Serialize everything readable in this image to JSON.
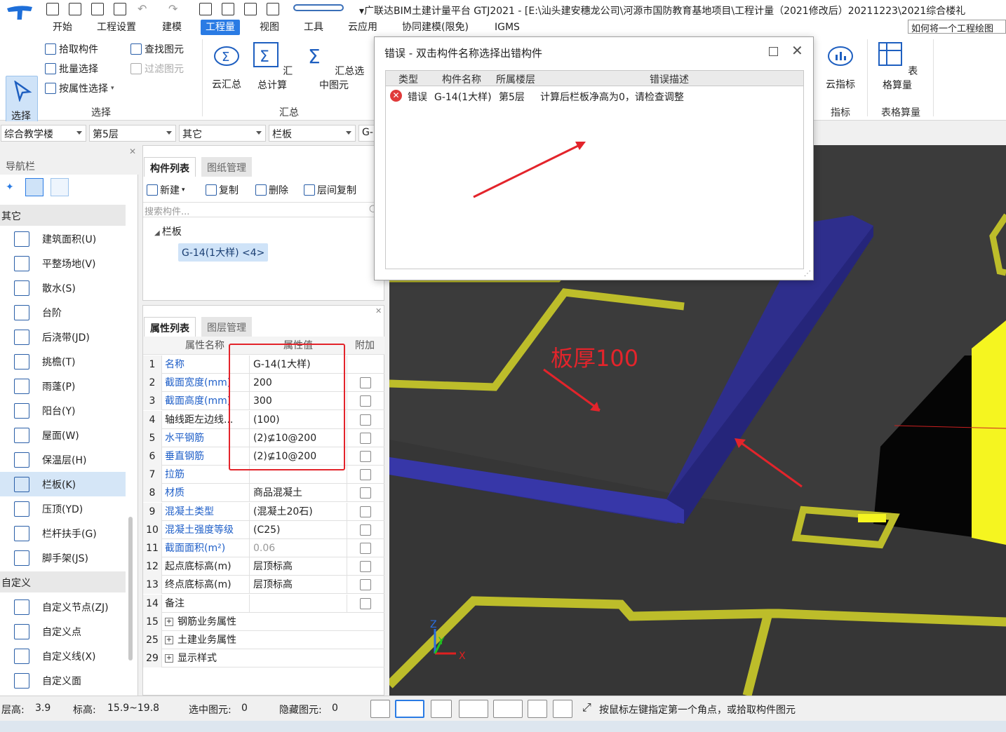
{
  "window": {
    "title": "▾广联达BIM土建计量平台 GTJ2021 - [E:\\汕头建安穗龙公司\\河源市国防教育基地项目\\工程计量（2021修改后）20211223\\2021综合楼礼"
  },
  "menu": {
    "tabs": [
      "开始",
      "工程设置",
      "建模",
      "工程量",
      "视图",
      "工具",
      "云应用",
      "协同建模(限免)",
      "IGMS"
    ],
    "active_tab": "工程量",
    "help_search": "如何将一个工程绘图"
  },
  "ribbon": {
    "select_group": {
      "big_button": "选择",
      "small": [
        "拾取构件",
        "批量选择",
        "按属性选择"
      ],
      "small2": [
        "查找图元",
        "过滤图元"
      ],
      "label": "选择"
    },
    "summary_group": {
      "buttons": [
        "云汇总",
        "汇总计算",
        "汇总选中图元"
      ],
      "label": "汇总"
    },
    "index_group": {
      "button": "云指标",
      "label": "指标"
    },
    "table_group": {
      "button": "表格算量",
      "label": "表格算量"
    }
  },
  "dropdowns": [
    "综合教学楼",
    "第5层",
    "其它",
    "栏板",
    "G-"
  ],
  "nav": {
    "title": "导航栏",
    "section_other": "其它",
    "items": [
      "建筑面积(U)",
      "平整场地(V)",
      "散水(S)",
      "台阶",
      "后浇带(JD)",
      "挑檐(T)",
      "雨蓬(P)",
      "阳台(Y)",
      "屋面(W)",
      "保温层(H)",
      "栏板(K)",
      "压顶(YD)",
      "栏杆扶手(G)",
      "脚手架(JS)"
    ],
    "selected_item": "栏板(K)",
    "section_custom": "自定义",
    "custom_items": [
      "自定义节点(ZJ)",
      "自定义点",
      "自定义线(X)",
      "自定义面"
    ]
  },
  "component_list": {
    "tabs": [
      "构件列表",
      "图纸管理"
    ],
    "toolbar": [
      "新建",
      "复制",
      "删除",
      "层间复制"
    ],
    "search_placeholder": "搜索构件...",
    "tree_root": "栏板",
    "tree_child": "G-14(1大样) <4>"
  },
  "property_list": {
    "tabs": [
      "属性列表",
      "图层管理"
    ],
    "headers": [
      "属性名称",
      "属性值",
      "附加"
    ],
    "rows": [
      {
        "n": "1",
        "name": "名称",
        "value": "G-14(1大样)",
        "blue": true,
        "check": false
      },
      {
        "n": "2",
        "name": "截面宽度(mm)",
        "value": "200",
        "blue": true,
        "check": true
      },
      {
        "n": "3",
        "name": "截面高度(mm)",
        "value": "300",
        "blue": true,
        "check": true
      },
      {
        "n": "4",
        "name": "轴线距左边线...",
        "value": "(100)",
        "blue": false,
        "check": true
      },
      {
        "n": "5",
        "name": "水平钢筋",
        "value": "(2)⊈10@200",
        "blue": true,
        "check": true
      },
      {
        "n": "6",
        "name": "垂直钢筋",
        "value": "(2)⊈10@200",
        "blue": true,
        "check": true
      },
      {
        "n": "7",
        "name": "拉筋",
        "value": "",
        "blue": true,
        "check": true
      },
      {
        "n": "8",
        "name": "材质",
        "value": "商品混凝土",
        "blue": true,
        "check": true
      },
      {
        "n": "9",
        "name": "混凝土类型",
        "value": "(混凝土20石)",
        "blue": true,
        "check": true
      },
      {
        "n": "10",
        "name": "混凝土强度等级",
        "value": "(C25)",
        "blue": true,
        "check": true
      },
      {
        "n": "11",
        "name": "截面面积(m²)",
        "value": "0.06",
        "blue": true,
        "check": true,
        "grey": true
      },
      {
        "n": "12",
        "name": "起点底标高(m)",
        "value": "层顶标高",
        "blue": false,
        "check": true
      },
      {
        "n": "13",
        "name": "终点底标高(m)",
        "value": "层顶标高",
        "blue": false,
        "check": true
      },
      {
        "n": "14",
        "name": "备注",
        "value": "",
        "blue": false,
        "check": true
      },
      {
        "n": "15",
        "name": "钢筋业务属性",
        "value": "",
        "expand": true
      },
      {
        "n": "25",
        "name": "土建业务属性",
        "value": "",
        "expand": true
      },
      {
        "n": "29",
        "name": "显示样式",
        "value": "",
        "expand": true
      }
    ]
  },
  "dialog": {
    "title": "错误 - 双击构件名称选择出错构件",
    "headers": [
      "类型",
      "构件名称",
      "所属楼层",
      "错误描述"
    ],
    "row": {
      "type": "错误",
      "name": "G-14(1大样)",
      "floor": "第5层",
      "desc": "计算后栏板净高为0，请检查调整"
    }
  },
  "viewport": {
    "annotation": "板厚100",
    "axis_labels": [
      "Z",
      "Y",
      "X"
    ]
  },
  "status": {
    "floor_height_label": "层高:",
    "floor_height": "3.9",
    "elevation_label": "标高:",
    "elevation": "15.9~19.8",
    "selected_label": "选中图元:",
    "selected": "0",
    "hidden_label": "隐藏图元:",
    "hidden": "0",
    "hint": "按鼠标左键指定第一个角点，或拾取构件图元"
  },
  "colors": {
    "accent": "#2a7be4",
    "annotation_red": "#e3242b",
    "parapet_blue": "#2e2e8c",
    "yellow_line": "#bdbd2a"
  }
}
